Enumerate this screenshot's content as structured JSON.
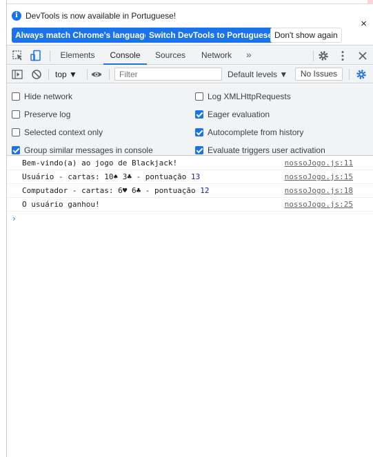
{
  "infobar": {
    "message": "DevTools is now available in Portuguese!",
    "match_button": "Always match Chrome's language",
    "switch_button": "Switch DevTools to Portuguese",
    "dismiss_button": "Don't show again",
    "close_glyph": "×"
  },
  "tabs": {
    "items": [
      "Elements",
      "Console",
      "Sources",
      "Network"
    ],
    "active": "Console",
    "more_glyph": "»",
    "right_icons": [
      "gear-icon",
      "kebab-menu-icon",
      "close-icon"
    ]
  },
  "toolbar": {
    "context": "top ▼",
    "filter_placeholder": "Filter",
    "levels": "Default levels ▼",
    "issues": "No Issues"
  },
  "settings": {
    "left": [
      {
        "label": "Hide network",
        "checked": false
      },
      {
        "label": "Preserve log",
        "checked": false
      },
      {
        "label": "Selected context only",
        "checked": false
      },
      {
        "label": "Group similar messages in console",
        "checked": true
      }
    ],
    "right": [
      {
        "label": "Log XMLHttpRequests",
        "checked": false
      },
      {
        "label": "Eager evaluation",
        "checked": true
      },
      {
        "label": "Autocomplete from history",
        "checked": true
      },
      {
        "label": "Evaluate triggers user activation",
        "checked": true
      }
    ]
  },
  "console": {
    "messages": [
      {
        "text": "Bem-vindo(a) ao jogo de Blackjack!",
        "number": "",
        "source": "nossoJogo.js:11"
      },
      {
        "text": "Usuário - cartas: 10♠ 3♣ - pontuação ",
        "number": "13",
        "source": "nossoJogo.js:15"
      },
      {
        "text": "Computador - cartas: 6♥ 6♣ - pontuação ",
        "number": "12",
        "source": "nossoJogo.js:18"
      },
      {
        "text": "O usuário ganhou!",
        "number": "",
        "source": "nossoJogo.js:25"
      }
    ],
    "prompt_glyph": "›"
  },
  "colors": {
    "accent": "#1a73e8",
    "toolbar_bg": "#f1f3f4",
    "number": "#1a1aa6"
  }
}
